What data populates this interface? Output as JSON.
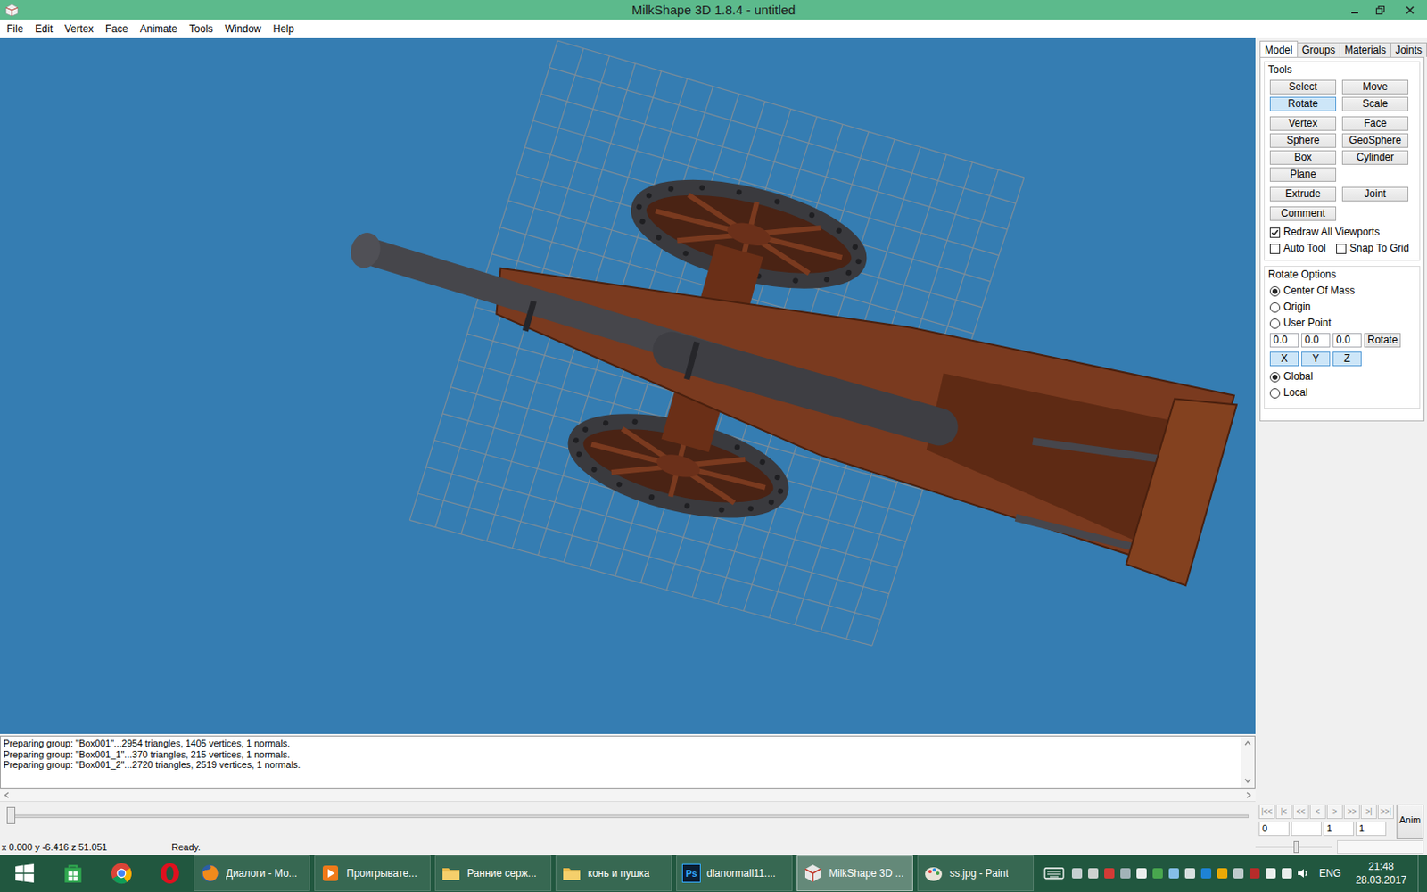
{
  "window": {
    "title": "MilkShape 3D 1.8.4 - untitled"
  },
  "menu": [
    "File",
    "Edit",
    "Vertex",
    "Face",
    "Animate",
    "Tools",
    "Window",
    "Help"
  ],
  "panel": {
    "tabs": [
      {
        "label": "Model",
        "selected": true
      },
      {
        "label": "Groups",
        "selected": false
      },
      {
        "label": "Materials",
        "selected": false
      },
      {
        "label": "Joints",
        "selected": false
      }
    ],
    "tools_title": "Tools",
    "tool_groups": [
      [
        {
          "label": "Select",
          "selected": false
        },
        {
          "label": "Move",
          "selected": false
        },
        {
          "label": "Rotate",
          "selected": true
        },
        {
          "label": "Scale",
          "selected": false
        }
      ],
      [
        {
          "label": "Vertex",
          "selected": false
        },
        {
          "label": "Face",
          "selected": false
        },
        {
          "label": "Sphere",
          "selected": false
        },
        {
          "label": "GeoSphere",
          "selected": false
        },
        {
          "label": "Box",
          "selected": false
        },
        {
          "label": "Cylinder",
          "selected": false
        },
        {
          "label": "Plane",
          "selected": false
        }
      ],
      [
        {
          "label": "Extrude",
          "selected": false
        },
        {
          "label": "Joint",
          "selected": false
        }
      ],
      [
        {
          "label": "Comment",
          "selected": false
        }
      ]
    ],
    "options": [
      {
        "label": "Redraw All Viewports",
        "checked": true
      },
      {
        "label": "Auto Tool",
        "checked": false
      },
      {
        "label": "Snap To Grid",
        "checked": false
      }
    ],
    "rotate_options": {
      "title": "Rotate Options",
      "centers": [
        {
          "label": "Center Of Mass",
          "selected": true
        },
        {
          "label": "Origin",
          "selected": false
        },
        {
          "label": "User Point",
          "selected": false
        }
      ],
      "user_point": [
        "0.0",
        "0.0",
        "0.0"
      ],
      "apply_button": "Rotate",
      "axes": [
        {
          "label": "X",
          "selected": true
        },
        {
          "label": "Y",
          "selected": true
        },
        {
          "label": "Z",
          "selected": true
        }
      ],
      "spaces": [
        {
          "label": "Global",
          "selected": true
        },
        {
          "label": "Local",
          "selected": false
        }
      ]
    }
  },
  "log": [
    "Preparing group: \"Box001\"...2954 triangles, 1405 vertices, 1 normals.",
    "Preparing group: \"Box001_1\"...370 triangles, 215 vertices, 1 normals.",
    "Preparing group: \"Box001_2\"...2720 triangles, 2519 vertices, 1 normals."
  ],
  "timeline": {
    "level": 0,
    "buttons": [
      {
        "label": "|<<",
        "disabled": true
      },
      {
        "label": "|<",
        "disabled": true
      },
      {
        "label": "<<",
        "disabled": true
      },
      {
        "label": "<",
        "disabled": true
      },
      {
        "label": ">",
        "disabled": true
      },
      {
        "label": ">>",
        "disabled": true
      },
      {
        "label": ">|",
        "disabled": true
      },
      {
        "label": ">>|",
        "disabled": true
      }
    ],
    "fields": [
      "0",
      "",
      "1",
      "1"
    ],
    "anim_button": "Anim",
    "speed_level": 0.5
  },
  "status_bar": {
    "coords": "x 0.000 y -6.416 z 51.051",
    "message": "Ready."
  },
  "taskbar": {
    "pinned": [
      {
        "kind": "start"
      },
      {
        "kind": "store"
      },
      {
        "kind": "chrome"
      },
      {
        "kind": "opera"
      }
    ],
    "items": [
      {
        "label": "Диалоги - Мо...",
        "kind": "firefox",
        "selected": false
      },
      {
        "label": "Проигрывате...",
        "kind": "player",
        "selected": false
      },
      {
        "label": "Ранние серж...",
        "kind": "folder",
        "selected": false
      },
      {
        "label": "конь и пушка",
        "kind": "folder",
        "selected": false
      },
      {
        "label": "dlanormall11....",
        "kind": "photoshop",
        "icon_label": "Ps",
        "selected": false
      },
      {
        "label": "MilkShape 3D ...",
        "kind": "milkshape",
        "selected": true
      },
      {
        "label": "ss.jpg - Paint",
        "kind": "paint",
        "selected": false
      }
    ],
    "language": "ENG",
    "time": "21:48",
    "date": "28.03.2017"
  }
}
